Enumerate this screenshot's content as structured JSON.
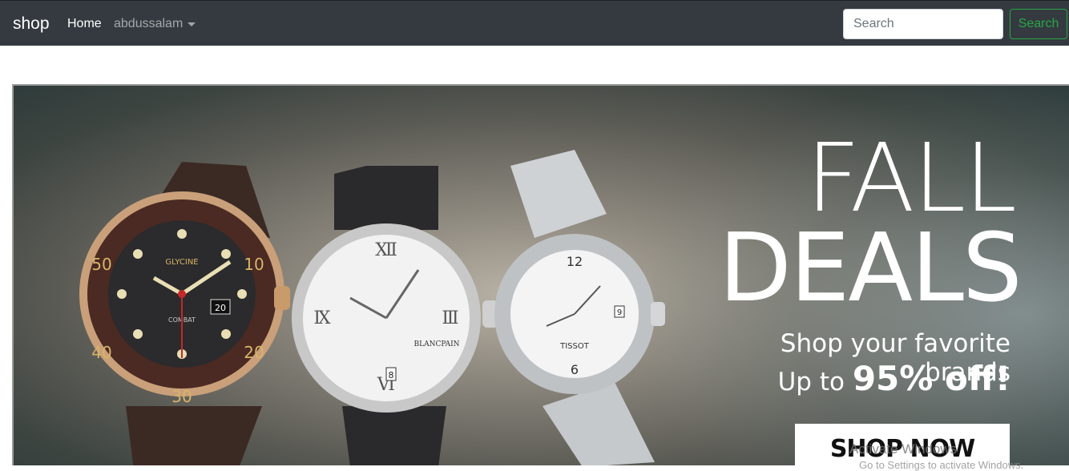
{
  "navbar": {
    "brand": "shop",
    "links": [
      {
        "label": "Home"
      },
      {
        "label": "abdussalam"
      }
    ],
    "search": {
      "placeholder": "Search",
      "value": "",
      "button_label": "Search"
    },
    "colors": {
      "background": "#343a40",
      "search_accent": "#28a745"
    }
  },
  "banner": {
    "headline_line1": "FALL",
    "headline_line2": "DEALS",
    "tagline": "Shop your favorite brands",
    "offer_prefix": "Up to ",
    "offer_strong": "95% off!",
    "cta_label": "SHOP NOW"
  },
  "watermark": {
    "line1": "Activate Windows",
    "line2": "Go to Settings to activate Windows."
  },
  "watch_labels": {
    "left_bezel_numbers": [
      "10",
      "20",
      "30",
      "40",
      "50"
    ],
    "left_dial_date": "20",
    "left_dial_brand": "GLYCINE",
    "left_dial_model": "COMBAT",
    "center_dial_brand": "BLANCPAIN",
    "center_dial_date": "8",
    "right_dial_brand": "TISSOT",
    "right_dial_numbers": [
      "12",
      "6"
    ],
    "right_dial_date": "9"
  }
}
